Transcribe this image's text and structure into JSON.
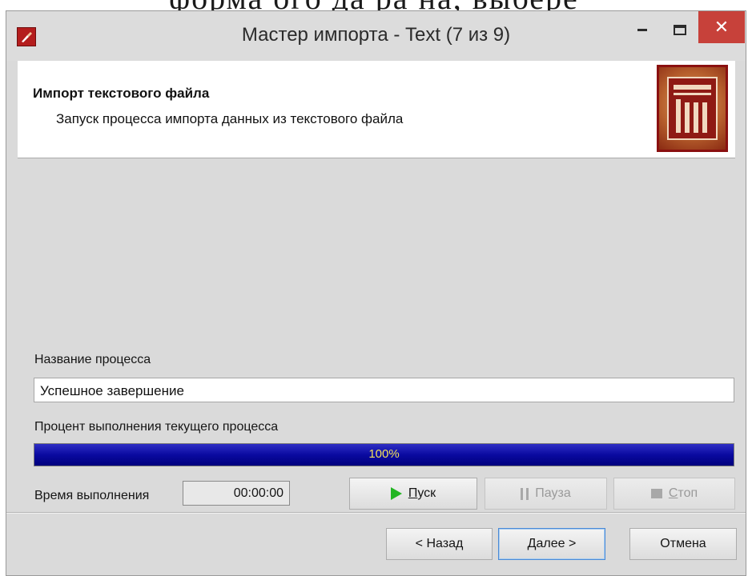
{
  "background_text": "форма               ого да ра на, выбере",
  "window": {
    "title": "Мастер импорта - Text (7 из 9)",
    "close_glyph": "✕",
    "icons": {
      "app": "app-import-icon",
      "minimize": "minimize-icon",
      "maximize": "maximize-icon",
      "close": "close-icon"
    }
  },
  "header": {
    "title": "Импорт текстового файла",
    "subtitle": "Запуск процесса импорта данных из текстового файла",
    "logo": "import-wizard-logo"
  },
  "process": {
    "name_label": "Название процесса",
    "name_value": "Успешное завершение",
    "percent_label": "Процент выполнения текущего процесса",
    "progress_value": 100,
    "progress_text": "100%",
    "time_label": "Время выполнения",
    "time_value": "00:00:00"
  },
  "controls": {
    "start": {
      "label_accel": "П",
      "label_rest": "уск",
      "enabled": true,
      "icon": "play-icon"
    },
    "pause": {
      "label_accel": "",
      "label_rest": "Пауза",
      "enabled": false,
      "icon": "pause-icon"
    },
    "stop": {
      "label_accel": "С",
      "label_rest": "топ",
      "enabled": false,
      "icon": "stop-icon"
    }
  },
  "footer": {
    "back_label": "< Назад",
    "next_label": "Далее >",
    "cancel_label": "Отмена"
  },
  "colors": {
    "close_button": "#c7413a",
    "progress_fill": "#0a0aa0",
    "progress_text": "#f2e15b",
    "play_icon": "#22b522",
    "logo_frame": "#8a1010"
  }
}
